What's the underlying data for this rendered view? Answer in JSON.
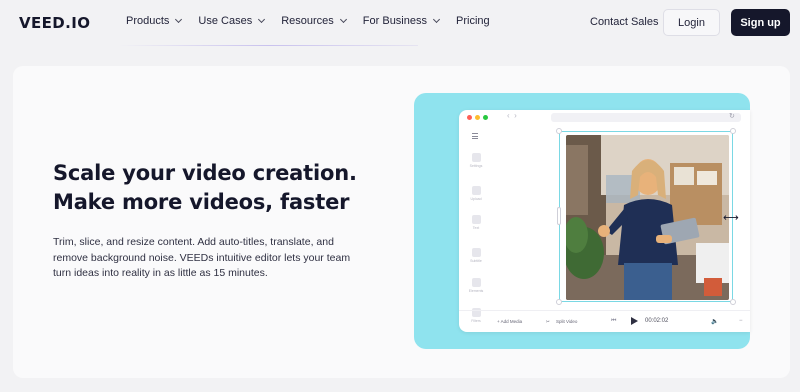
{
  "brand": {
    "logo": "VEED.IO"
  },
  "nav": {
    "items": [
      {
        "label": "Products",
        "has_dropdown": true
      },
      {
        "label": "Use Cases",
        "has_dropdown": true
      },
      {
        "label": "Resources",
        "has_dropdown": true
      },
      {
        "label": "For Business",
        "has_dropdown": true
      },
      {
        "label": "Pricing",
        "has_dropdown": false
      }
    ],
    "contact": "Contact Sales",
    "login": "Login",
    "signup": "Sign up"
  },
  "hero": {
    "headline_line1": "Scale your video creation.",
    "headline_line2": "Make more videos, faster",
    "body": "Trim, slice, and resize content. Add auto-titles, translate, and remove background noise. VEEDs intuitive editor lets your team turn ideas into reality in as little as 15 minutes."
  },
  "editor": {
    "sidebar": [
      "Settings",
      "Upload",
      "Text",
      "Subtitle",
      "Elements",
      "Filters"
    ],
    "add_media": "+ Add Media",
    "split_video": "Split Video",
    "timecode": "00:02:02"
  },
  "colors": {
    "accent_teal": "#8fe3ee",
    "signup_bg": "#15172b",
    "traffic_red": "#ff5f57",
    "traffic_yellow": "#febc2e",
    "traffic_green": "#28c840"
  }
}
